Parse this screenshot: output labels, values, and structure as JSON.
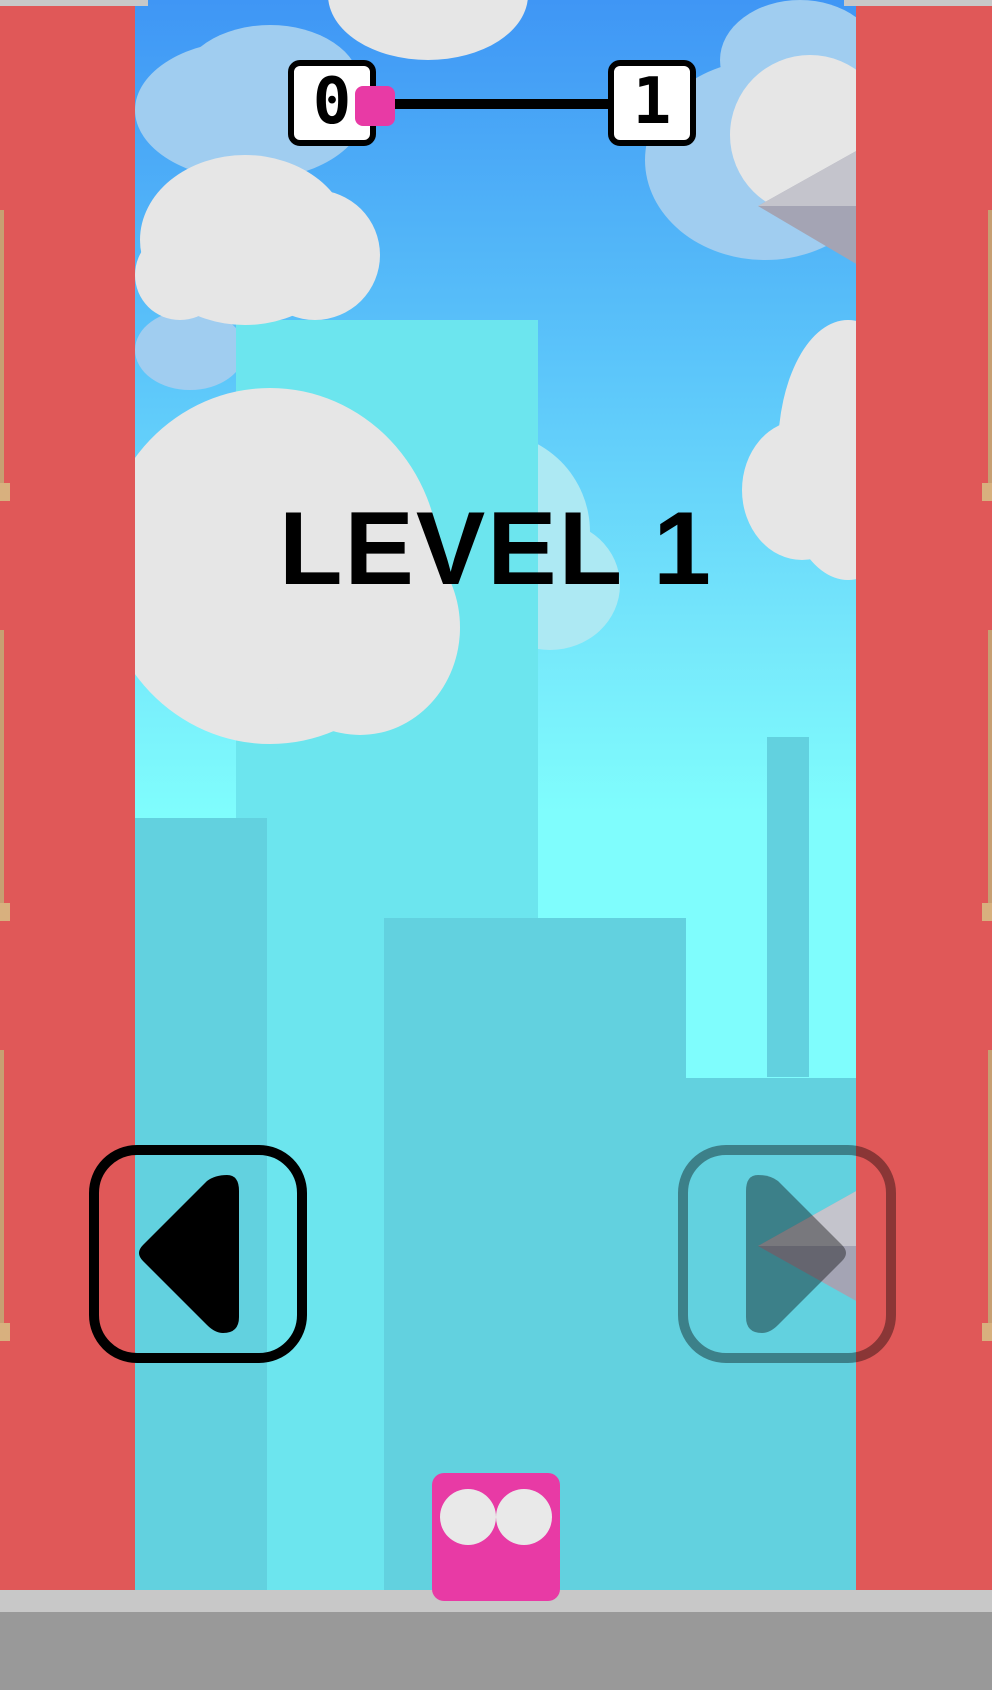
{
  "hud": {
    "current_level": "0",
    "next_level": "1",
    "progress": 0.0
  },
  "level_title": "LEVEL 1",
  "controls": {
    "left_icon": "arrow-left-icon",
    "right_icon": "arrow-right-icon",
    "right_enabled": false
  },
  "player": {
    "color": "#e83aa5"
  },
  "colors": {
    "wall": "#e05858",
    "sky_top": "#3f96f5",
    "sky_bottom": "#7ffdfd",
    "ground": "#999999",
    "player": "#e83aa5"
  }
}
